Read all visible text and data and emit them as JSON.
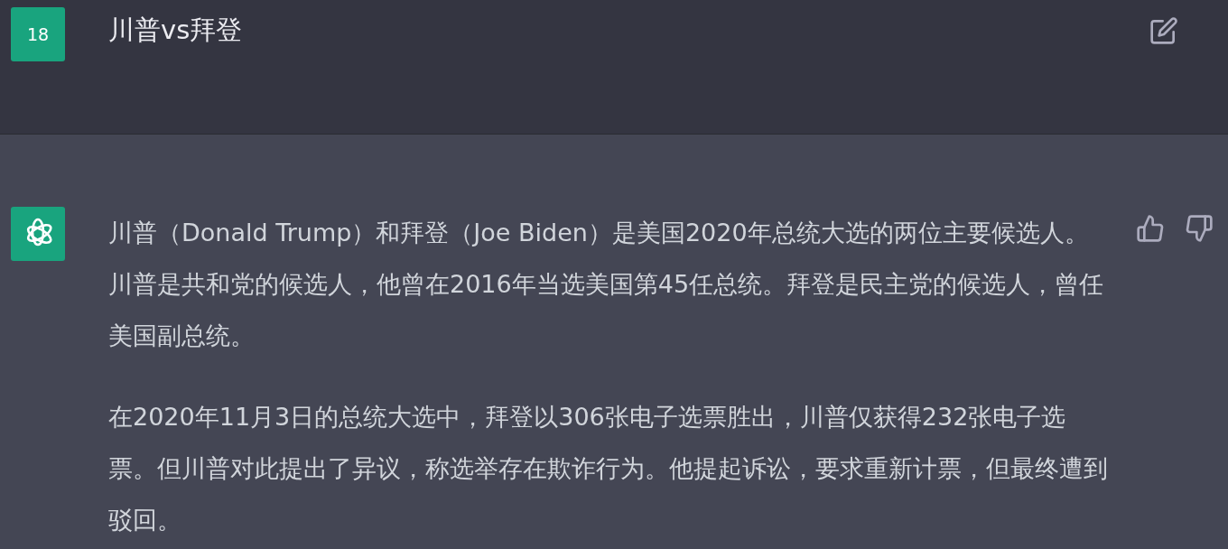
{
  "user_message": {
    "avatar": "18",
    "text": "川普vs拜登"
  },
  "assistant_message": {
    "paragraphs": [
      "川普（Donald Trump）和拜登（Joe Biden）是美国2020年总统大选的两位主要候选人。川普是共和党的候选人，他曾在2016年当选美国第45任总统。拜登是民主党的候选人，曾任美国副总统。",
      "在2020年11月3日的总统大选中，拜登以306张电子选票胜出，川普仅获得232张电子选票。但川普对此提出了异议，称选举存在欺诈行为。他提起诉讼，要求重新计票，但最终遭到驳回。"
    ]
  }
}
